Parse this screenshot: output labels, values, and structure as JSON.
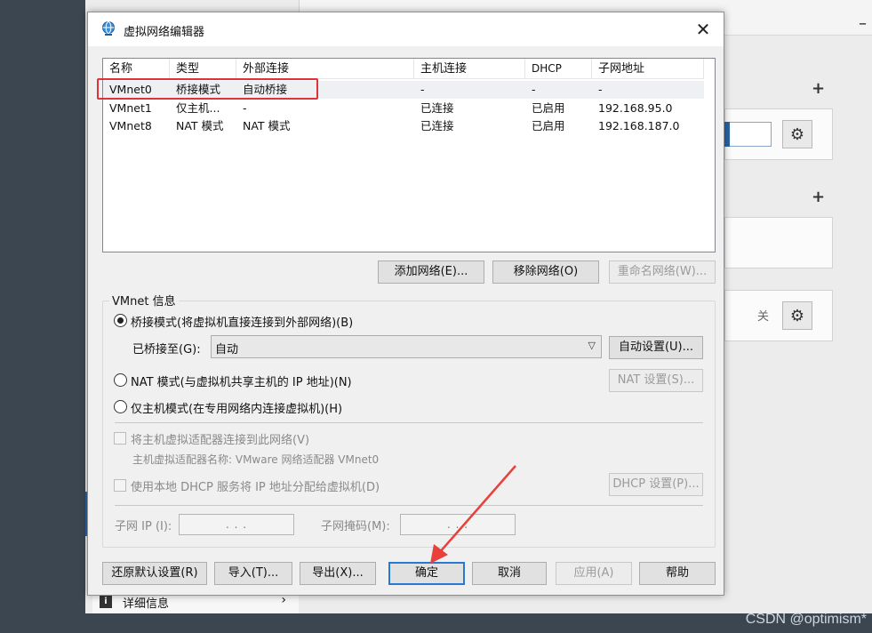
{
  "dialog": {
    "title": "虚拟网络编辑器",
    "columns": [
      "名称",
      "类型",
      "外部连接",
      "主机连接",
      "DHCP",
      "子网地址"
    ],
    "rows": [
      [
        "VMnet0",
        "桥接模式",
        "自动桥接",
        "-",
        "-",
        "-"
      ],
      [
        "VMnet1",
        "仅主机...",
        "-",
        "已连接",
        "已启用",
        "192.168.95.0"
      ],
      [
        "VMnet8",
        "NAT 模式",
        "NAT 模式",
        "已连接",
        "已启用",
        "192.168.187.0"
      ]
    ],
    "list_buttons": {
      "add": "添加网络(E)...",
      "remove": "移除网络(O)",
      "rename": "重命名网络(W)..."
    },
    "vmnet_info": {
      "label": "VMnet 信息",
      "bridge_radio": "桥接模式(将虚拟机直接连接到外部网络)(B)",
      "bridged_to_label": "已桥接至(G):",
      "bridged_to_value": "自动",
      "auto_settings": "自动设置(U)...",
      "nat_radio": "NAT 模式(与虚拟机共享主机的 IP 地址)(N)",
      "nat_settings": "NAT 设置(S)...",
      "host_only_radio": "仅主机模式(在专用网络内连接虚拟机)(H)",
      "connect_adapter": "将主机虚拟适配器连接到此网络(V)",
      "adapter_name": "主机虚拟适配器名称: VMware 网络适配器 VMnet0",
      "use_dhcp": "使用本地 DHCP 服务将 IP 地址分配给虚拟机(D)",
      "dhcp_settings": "DHCP 设置(P)...",
      "subnet_ip_label": "子网 IP (I):",
      "subnet_mask_label": "子网掩码(M):",
      "ip_placeholder": ".   .   ."
    },
    "footer": {
      "restore": "还原默认设置(R)",
      "import": "导入(T)...",
      "export": "导出(X)...",
      "ok": "确定",
      "cancel": "取消",
      "apply": "应用(A)",
      "help": "帮助"
    }
  },
  "background": {
    "off_label": "关",
    "detail_label": "详细信息"
  },
  "watermark": "CSDN @optimism*",
  "colors": {
    "highlight_box": "#e0323b",
    "arrow": "#e8413c",
    "primary_border": "#2a78d2"
  }
}
